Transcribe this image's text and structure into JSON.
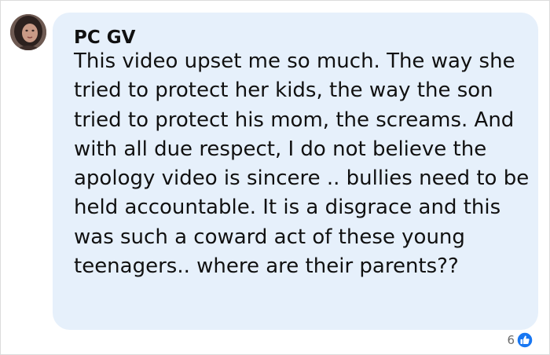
{
  "comment": {
    "author": "PC GV",
    "text": "This video upset me so much. The way she tried to protect her kids, the way the son tried to protect his mom, the screams. And with all due respect, I do not believe the apology video is sincere .. bullies need to be held accountable. It is a disgrace and this was such a coward act of these young teenagers.. where are their parents??",
    "avatar_icon": "profile-photo",
    "reactions": {
      "count": "6",
      "icon": "like-thumbs-up-icon",
      "icon_color": "#1877f2"
    },
    "bubble_color": "#e6f0fb"
  }
}
